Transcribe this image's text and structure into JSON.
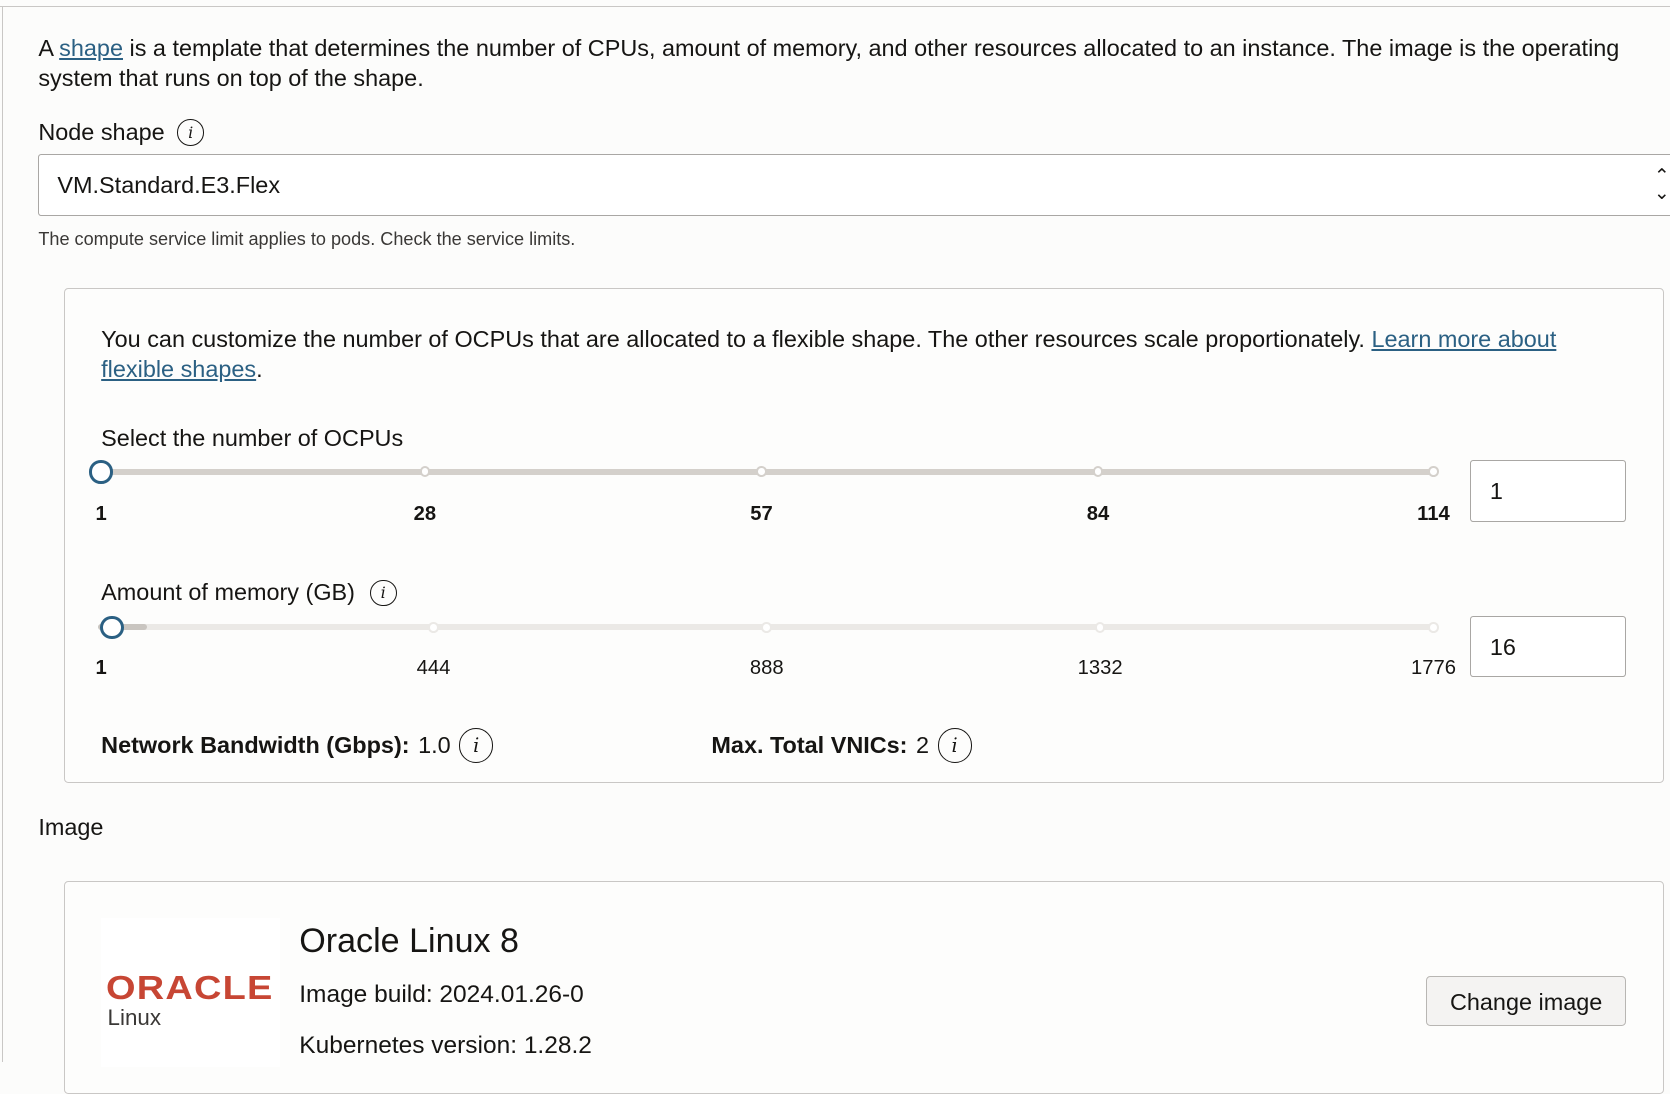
{
  "intro": {
    "prefix": "A ",
    "link": "shape",
    "suffix": " is a template that determines the number of CPUs, amount of memory, and other resources allocated to an instance. The image is the operating system that runs on top of the shape."
  },
  "node_shape": {
    "label": "Node shape",
    "value": "VM.Standard.E3.Flex",
    "help": "The compute service limit applies to pods. Check the service limits."
  },
  "flex": {
    "text": "You can customize the number of OCPUs that are allocated to a flexible shape. The other resources scale proportionately. ",
    "link": "Learn more about flexible shapes",
    "period": ".",
    "ocpu": {
      "label": "Select the number of OCPUs",
      "ticks": [
        "1",
        "28",
        "57",
        "84",
        "114"
      ],
      "value": "1",
      "min": 1,
      "max": 114
    },
    "memory": {
      "label": "Amount of memory (GB)",
      "ticks": [
        "1",
        "444",
        "888",
        "1332",
        "1776"
      ],
      "value": "16",
      "min": 1,
      "max": 1776
    },
    "bandwidth": {
      "label": "Network Bandwidth (Gbps):",
      "value": "1.0"
    },
    "vnics": {
      "label": "Max. Total VNICs:",
      "value": "2"
    }
  },
  "image": {
    "section_label": "Image",
    "logo_brand": "ORACLE",
    "logo_sub": "Linux",
    "name": "Oracle Linux 8",
    "build": "Image build: 2024.01.26-0",
    "k8s": "Kubernetes version: 1.28.2",
    "change_button": "Change image"
  },
  "colors": {
    "accent": "#2b6083",
    "oracle_red": "#c74634"
  }
}
